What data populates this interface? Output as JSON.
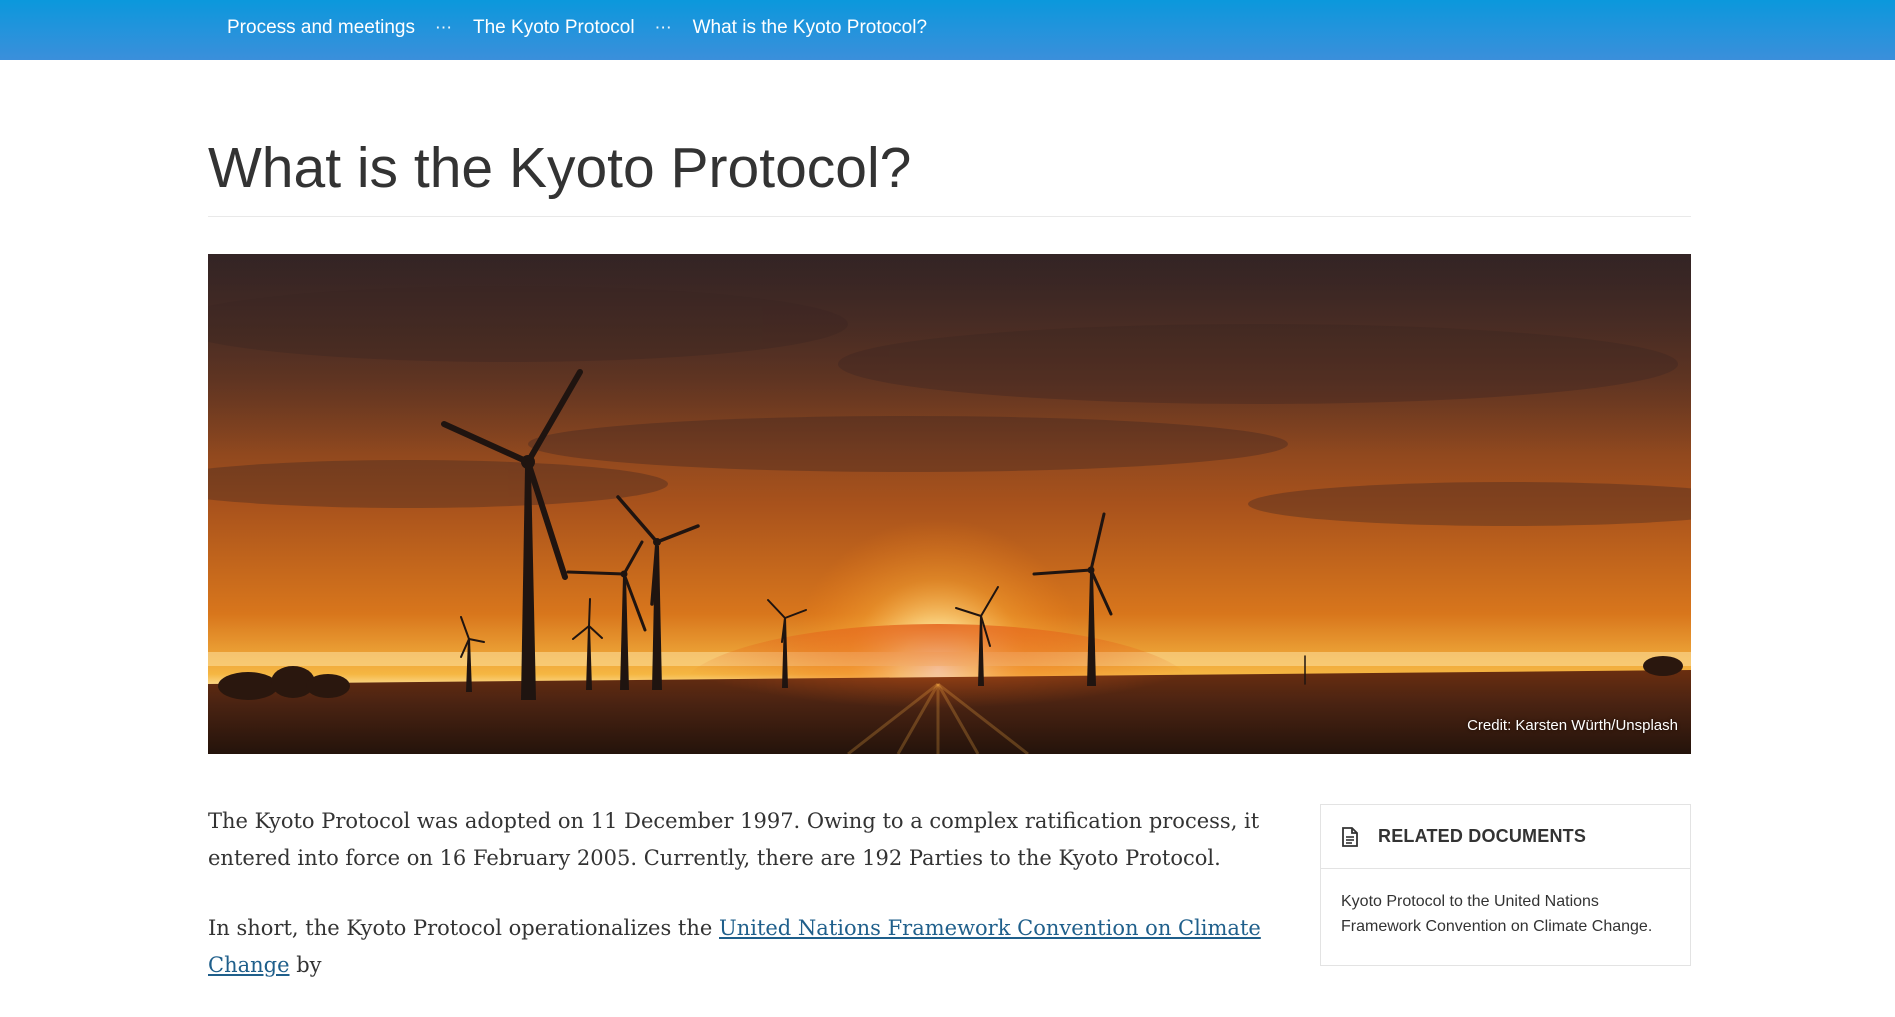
{
  "breadcrumb": {
    "items": [
      "Process and meetings",
      "The Kyoto Protocol",
      "What is the Kyoto Protocol?"
    ],
    "separator": "⋯"
  },
  "page": {
    "title": "What is the Kyoto Protocol?"
  },
  "hero": {
    "credit": "Credit: Karsten Würth/Unsplash"
  },
  "content": {
    "p1": "The Kyoto Protocol was adopted on 11 December 1997. Owing to a complex ratification process, it entered into force on 16 February 2005. Currently, there are 192 Parties to the Kyoto Protocol.",
    "p2_start": "In short, the Kyoto Protocol operationalizes the ",
    "p2_link": "United Nations Framework Convention on Climate Change",
    "p2_end": " by"
  },
  "sidebar": {
    "heading": "RELATED DOCUMENTS",
    "heading_icon": "document-icon",
    "doc": "Kyoto Protocol to the United Nations Framework Convention on Climate Change."
  },
  "colors": {
    "topbar": "#0b98dc",
    "link": "#1f5f8b",
    "text": "#333333"
  }
}
